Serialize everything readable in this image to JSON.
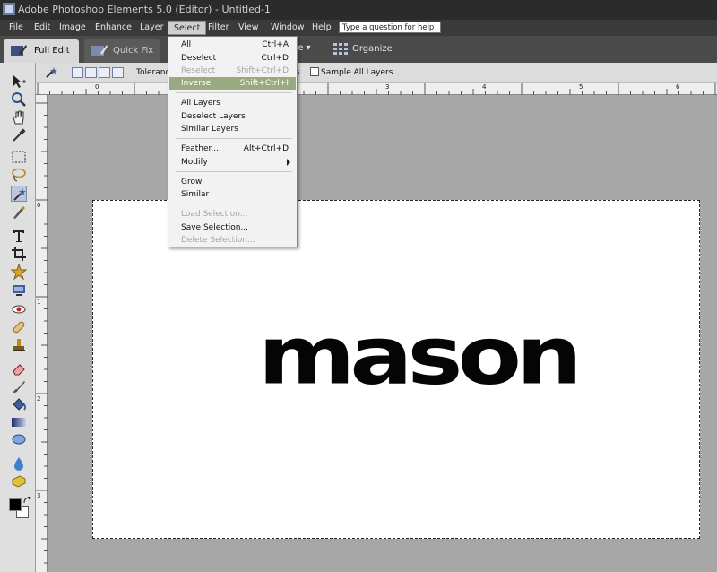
{
  "window": {
    "title": "Adobe Photoshop Elements 5.0 (Editor) - Untitled-1"
  },
  "menubar": {
    "items": [
      "File",
      "Edit",
      "Image",
      "Enhance",
      "Layer",
      "Select",
      "Filter",
      "View",
      "Window",
      "Help"
    ],
    "active": "Select",
    "help_placeholder": "Type a question for help"
  },
  "tabs": {
    "full_edit": "Full Edit",
    "quick_fix": "Quick Fix",
    "create": "eate ▾",
    "organize": "Organize"
  },
  "options_bar": {
    "tolerance_label": "Toleranc",
    "contiguous_tail": "s",
    "sample_all_layers": "Sample All Layers"
  },
  "select_menu": {
    "all": {
      "label": "All",
      "shortcut": "Ctrl+A"
    },
    "deselect": {
      "label": "Deselect",
      "shortcut": "Ctrl+D"
    },
    "reselect": {
      "label": "Reselect",
      "shortcut": "Shift+Ctrl+D"
    },
    "inverse": {
      "label": "Inverse",
      "shortcut": "Shift+Ctrl+I"
    },
    "all_layers": "All Layers",
    "deselect_layers": "Deselect Layers",
    "similar_layers": "Similar Layers",
    "feather": {
      "label": "Feather...",
      "shortcut": "Alt+Ctrl+D"
    },
    "modify": "Modify",
    "grow": "Grow",
    "similar": "Similar",
    "load_selection": "Load Selection...",
    "save_selection": "Save Selection...",
    "delete_selection": "Delete Selection..."
  },
  "rulers": {
    "top": [
      "0",
      "1",
      "3",
      "4",
      "5",
      "6"
    ],
    "left": [
      "0",
      "1",
      "2",
      "3"
    ]
  },
  "canvas": {
    "text": "mason"
  },
  "colors": {
    "accent_highlight": "#99aa80",
    "menubar": "#3a3a3a",
    "foreground_swatch": "#000000",
    "background_swatch": "#ffffff"
  }
}
